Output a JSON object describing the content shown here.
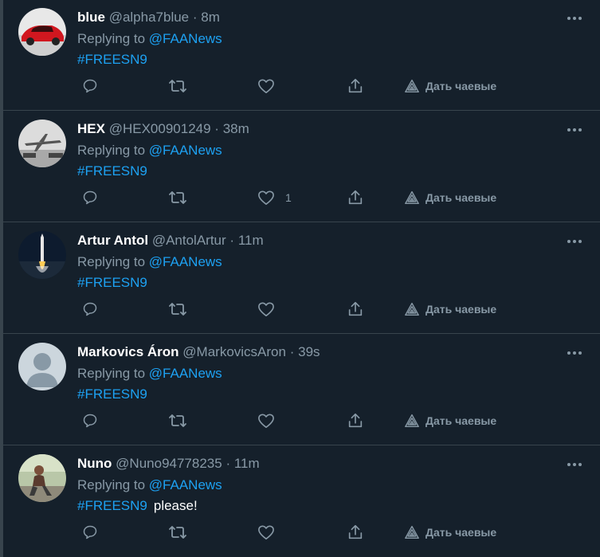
{
  "colors": {
    "background": "#15202b",
    "divider": "#38444d",
    "text_primary": "#ffffff",
    "text_secondary": "#8899a6",
    "accent": "#1da1f2"
  },
  "actions": {
    "reply_icon": "reply-icon",
    "retweet_icon": "retweet-icon",
    "like_icon": "like-icon",
    "share_icon": "share-icon",
    "tip_icon": "tip-icon",
    "tip_label": "Дать чаевые",
    "more_icon": "more-icon"
  },
  "tweets": [
    {
      "name": "blue",
      "handle": "@alpha7blue",
      "dot": "·",
      "time": "8m",
      "replying_prefix": "Replying to",
      "mention": "@FAANews",
      "hashtag": "#FREESN9",
      "text": "",
      "like_count": "",
      "avatar": "red-sports-car"
    },
    {
      "name": "HEX",
      "handle": "@HEX00901249",
      "dot": "·",
      "time": "38m",
      "replying_prefix": "Replying to",
      "mention": "@FAANews",
      "hashtag": "#FREESN9",
      "text": "",
      "like_count": "1",
      "avatar": "airplane"
    },
    {
      "name": "Artur Antol",
      "handle": "@AntolArtur",
      "dot": "·",
      "time": "11m",
      "replying_prefix": "Replying to",
      "mention": "@FAANews",
      "hashtag": "#FREESN9",
      "text": "",
      "like_count": "",
      "avatar": "rocket-launch"
    },
    {
      "name": "Markovics Áron",
      "handle": "@MarkovicsAron",
      "dot": "·",
      "time": "39s",
      "replying_prefix": "Replying to",
      "mention": "@FAANews",
      "hashtag": "#FREESN9",
      "text": "",
      "like_count": "",
      "avatar": "default-avatar"
    },
    {
      "name": "Nuno",
      "handle": "@Nuno94778235",
      "dot": "·",
      "time": "11m",
      "replying_prefix": "Replying to",
      "mention": "@FAANews",
      "hashtag": "#FREESN9",
      "text": "please!",
      "like_count": "",
      "avatar": "person-photo"
    }
  ]
}
